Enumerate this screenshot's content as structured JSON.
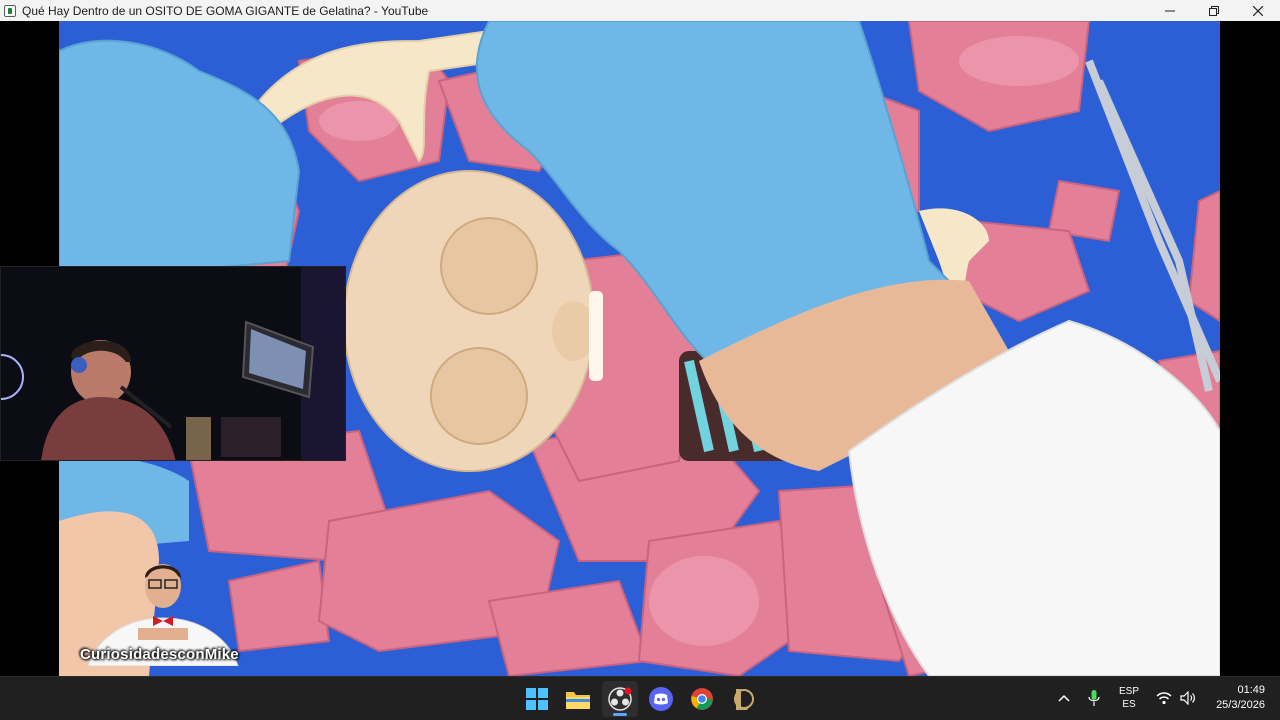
{
  "window": {
    "title": "Qué Hay Dentro de un OSITO DE GOMA GIGANTE de Gelatina? - YouTube",
    "app_icon": "app-window-icon",
    "controls": [
      "minimize-icon",
      "restore-icon",
      "close-icon"
    ]
  },
  "video": {
    "channel_watermark": "CuriosidadesconMike"
  },
  "taskbar": {
    "apps": [
      {
        "name": "windows-start",
        "icon": "windows-logo-icon"
      },
      {
        "name": "file-explorer",
        "icon": "folder-icon"
      },
      {
        "name": "obs-studio",
        "icon": "obs-icon"
      },
      {
        "name": "discord",
        "icon": "discord-icon"
      },
      {
        "name": "chrome",
        "icon": "chrome-icon"
      },
      {
        "name": "league-client",
        "icon": "league-icon"
      }
    ],
    "tray": {
      "language_top": "ESP",
      "language_bottom": "ES",
      "time": "01:49",
      "date": "25/3/2026"
    }
  },
  "colors": {
    "taskbar_bg": "#202020",
    "titlebar_bg": "#f3f3f3",
    "accent": "#5aa6ff"
  }
}
